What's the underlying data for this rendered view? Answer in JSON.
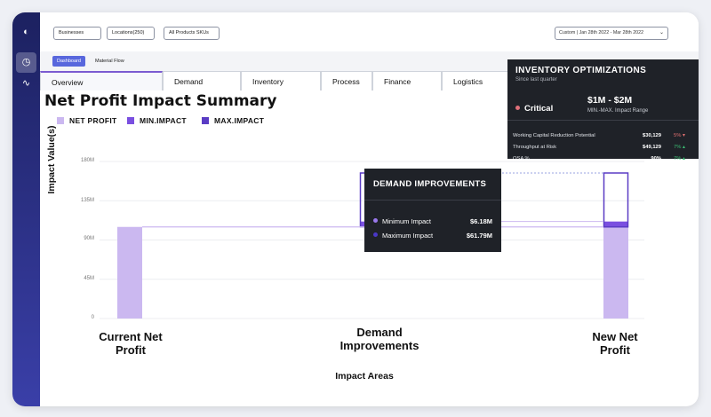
{
  "filters": {
    "businesses": "Businesses",
    "locations": "Locations(250)",
    "skus": "All Products SKUs",
    "date_range": "Custom | Jan 28th 2022 - Mar 28th 2022"
  },
  "subnav": {
    "items": [
      "Dashboard",
      "Material Flow"
    ],
    "active": "Dashboard"
  },
  "tabs": [
    "Overview",
    "Demand",
    "Inventory",
    "Process",
    "Finance",
    "Logistics"
  ],
  "active_tab": "Overview",
  "title": "Net Profit Impact Summary",
  "colors": {
    "net_profit": "#cbb8f0",
    "min_impact": "#7a4fe0",
    "max_impact": "#5a3cc4",
    "accent": "#5867dd",
    "critical": "#e0707a",
    "positive": "#3bbf74",
    "negative": "#e07070"
  },
  "chart_data": {
    "type": "bar",
    "legend": [
      "NET PROFIT",
      "MIN.IMPACT",
      "MAX.IMPACT"
    ],
    "ylabel": "Impact Value(s)",
    "xlabel": "Impact Areas",
    "y_ticks": [
      "180M",
      "135M",
      "90M",
      "45M",
      "0"
    ],
    "ylim": [
      0,
      180
    ],
    "categories": [
      "Current\nNet Profit",
      "Demand\nImprovements",
      "New\nNet Profit"
    ],
    "bars": [
      {
        "category": "Current Net Profit",
        "base": 0,
        "net_profit": 105
      },
      {
        "category": "Demand Improvements",
        "base": 105,
        "min_impact": 6.18,
        "max_impact": 61.79
      },
      {
        "category": "New Net Profit",
        "base": 0,
        "net_profit": 105,
        "min_impact": 6.18,
        "max_impact": 61.79
      }
    ]
  },
  "demand_tooltip": {
    "title": "DEMAND IMPROVEMENTS",
    "rows": [
      {
        "label": "Minimum Impact",
        "value": "$6.18M"
      },
      {
        "label": "Maximum Impact",
        "value": "$61.79M"
      }
    ]
  },
  "inventory_tooltip": {
    "title": "INVENTORY OPTIMIZATIONS",
    "subtitle": "Since last quarter",
    "status": "Critical",
    "range": "$1M - $2M",
    "range_label": "MIN.-MAX. Impact Range",
    "rows": [
      {
        "label": "Working Capital Reduction Potential",
        "value": "$30,129",
        "change": "5%",
        "trend": "down"
      },
      {
        "label": "Throughput at Risk",
        "value": "$49,129",
        "change": "7%",
        "trend": "up"
      },
      {
        "label": "OSA %",
        "value": "90%",
        "change": "7%",
        "trend": "up"
      }
    ]
  }
}
